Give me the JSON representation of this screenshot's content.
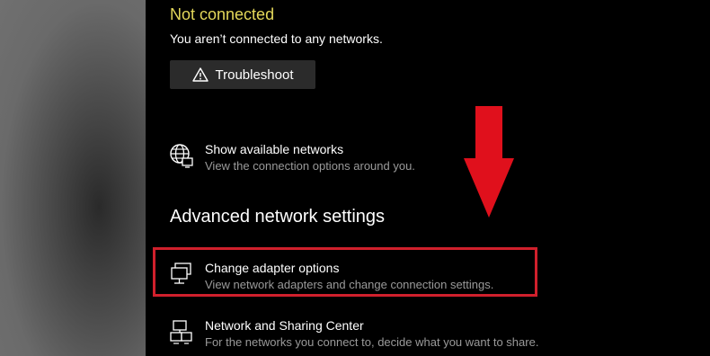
{
  "status": {
    "title": "Not connected",
    "description": "You aren’t connected to any networks."
  },
  "troubleshoot": {
    "label": "Troubleshoot",
    "icon": "warning-icon"
  },
  "show_networks": {
    "title": "Show available networks",
    "description": "View the connection options around you.",
    "icon": "globe-network-icon"
  },
  "advanced": {
    "heading": "Advanced network settings"
  },
  "adapter": {
    "title": "Change adapter options",
    "description": "View network adapters and change connection settings.",
    "icon": "adapter-icon"
  },
  "sharing": {
    "title": "Network and Sharing Center",
    "description": "For the networks you connect to, decide what you want to share.",
    "icon": "sharing-center-icon"
  },
  "colors": {
    "status_yellow": "#e3d75a",
    "highlight_red": "#d0202c",
    "arrow_red": "#e0101c",
    "background": "#000000"
  }
}
